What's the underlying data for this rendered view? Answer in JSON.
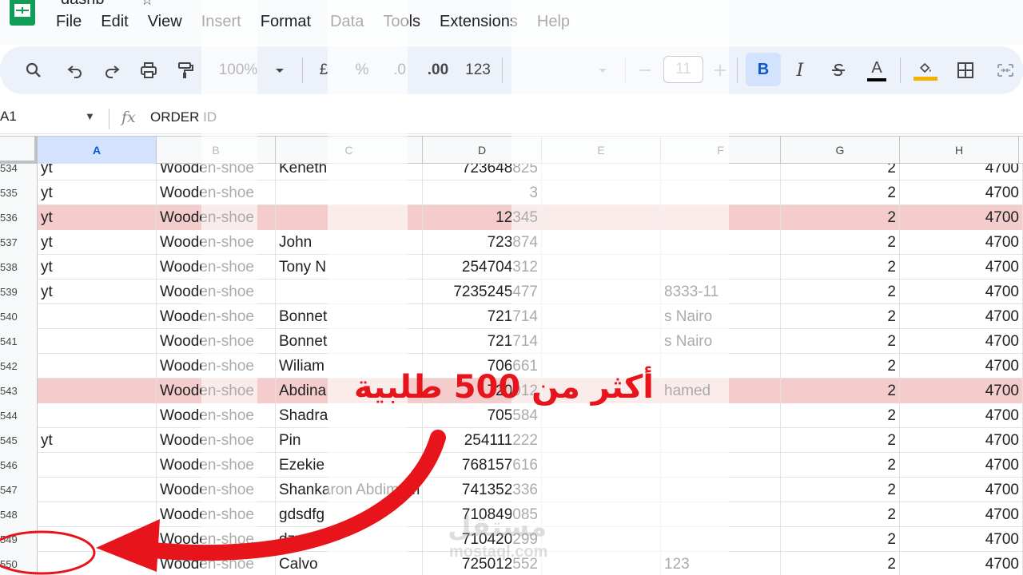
{
  "app": {
    "doc_title": "dasnb"
  },
  "menu": [
    "File",
    "Edit",
    "View",
    "Insert",
    "Format",
    "Data",
    "Tools",
    "Extensions",
    "Help"
  ],
  "toolbar": {
    "zoom": "100%",
    "currency": "£",
    "percent": "%",
    "dec_decrease": ".0",
    "dec_increase": ".00",
    "number_format": "123",
    "font_size": "11",
    "bold": "B",
    "italic": "I",
    "text_color": "A"
  },
  "formula_bar": {
    "cell_ref": "A1",
    "fx": "fx",
    "value": "ORDER ID"
  },
  "columns": [
    "A",
    "B",
    "C",
    "D",
    "E",
    "F",
    "G",
    "H"
  ],
  "rows": [
    {
      "num": "534",
      "a": "yt",
      "b": "Wooden-shoe",
      "c": "Keneth",
      "d": "723648825",
      "f": "",
      "g": "2",
      "h": "4700",
      "hl": false
    },
    {
      "num": "535",
      "a": "yt",
      "b": "Wooden-shoe",
      "c": "",
      "d": "3",
      "f": "",
      "g": "2",
      "h": "4700",
      "hl": false
    },
    {
      "num": "536",
      "a": "yt",
      "b": "Wooden-shoe",
      "c": "",
      "d": "12345",
      "f": "",
      "g": "2",
      "h": "4700",
      "hl": true
    },
    {
      "num": "537",
      "a": "yt",
      "b": "Wooden-shoe",
      "c": "John",
      "d": "723874",
      "f": "",
      "g": "2",
      "h": "4700",
      "hl": false
    },
    {
      "num": "538",
      "a": "yt",
      "b": "Wooden-shoe",
      "c": "Tony N",
      "d": "254704312",
      "f": "",
      "g": "2",
      "h": "4700",
      "hl": false
    },
    {
      "num": "539",
      "a": "yt",
      "b": "Wooden-shoe",
      "c": "",
      "d": "7235245477",
      "f": "8333-11",
      "g": "2",
      "h": "4700",
      "hl": false
    },
    {
      "num": "540",
      "a": "",
      "b": "Wooden-shoe",
      "c": "Bonnet",
      "d": "721714",
      "f": "s Nairo",
      "g": "2",
      "h": "4700",
      "hl": false
    },
    {
      "num": "541",
      "a": "",
      "b": "Wooden-shoe",
      "c": "Bonnet",
      "d": "721714",
      "f": "s Nairo",
      "g": "2",
      "h": "4700",
      "hl": false
    },
    {
      "num": "542",
      "a": "",
      "b": "Wooden-shoe",
      "c": "Wiliam",
      "d": "706661",
      "f": "",
      "g": "2",
      "h": "4700",
      "hl": false
    },
    {
      "num": "543",
      "a": "",
      "b": "Wooden-shoe",
      "c": "Abdina",
      "d": "720912",
      "f": "hamed",
      "g": "2",
      "h": "4700",
      "hl": true
    },
    {
      "num": "544",
      "a": "",
      "b": "Wooden-shoe",
      "c": "Shadra",
      "d": "705584",
      "f": "",
      "g": "2",
      "h": "4700",
      "hl": false
    },
    {
      "num": "545",
      "a": "yt",
      "b": "Wooden-shoe",
      "c": "Pin",
      "d": "254111222",
      "f": "",
      "g": "2",
      "h": "4700",
      "hl": false
    },
    {
      "num": "546",
      "a": "",
      "b": "Wooden-shoe",
      "c": "Ezekie",
      "d": "768157616",
      "f": "",
      "g": "2",
      "h": "4700",
      "hl": false
    },
    {
      "num": "547",
      "a": "",
      "b": "Wooden-shoe",
      "c": "Shankaron Abdimam",
      "d": "741352336",
      "f": "",
      "g": "2",
      "h": "4700",
      "hl": false
    },
    {
      "num": "548",
      "a": "",
      "b": "Wooden-shoe",
      "c": "gdsdfg",
      "d": "710849085",
      "f": "",
      "g": "2",
      "h": "4700",
      "hl": false
    },
    {
      "num": "549",
      "a": "",
      "b": "Wooden-shoe",
      "c": "dzxxffc",
      "d": "710420299",
      "f": "",
      "g": "2",
      "h": "4700",
      "hl": false
    },
    {
      "num": "550",
      "a": "",
      "b": "Wooden-shoe",
      "c": "Calvo",
      "d": "725012552",
      "f": "123",
      "g": "2",
      "h": "4700",
      "hl": false
    }
  ],
  "annotation": {
    "text": "أكثر من 500 طلبية",
    "color": "#e8141c"
  },
  "watermark": {
    "brand": "مستقل",
    "site": "mostaql.com"
  }
}
